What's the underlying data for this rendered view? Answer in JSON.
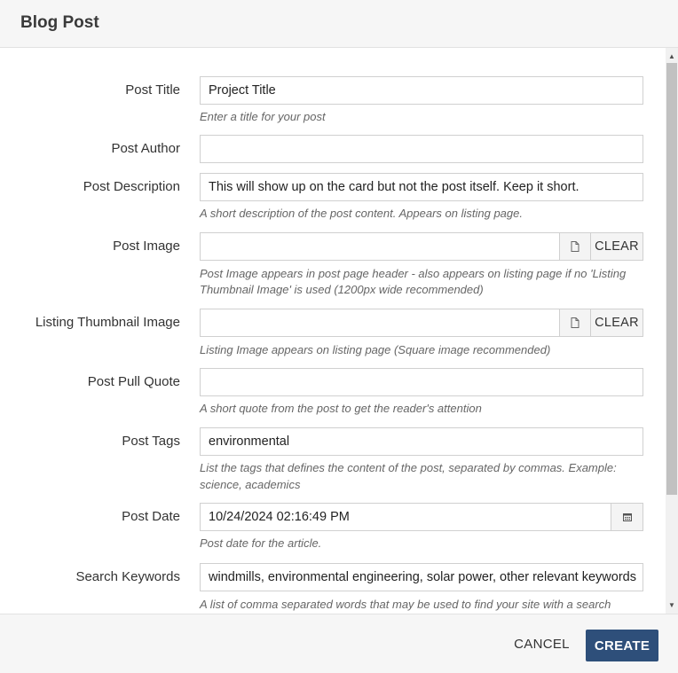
{
  "dialog": {
    "title": "Blog Post"
  },
  "fields": {
    "post_title": {
      "label": "Post Title",
      "value": "Project Title",
      "help": "Enter a title for your post"
    },
    "post_author": {
      "label": "Post Author",
      "value": ""
    },
    "post_description": {
      "label": "Post Description",
      "value": "This will show up on the card but not the post itself. Keep it short.",
      "help": "A short description of the post content. Appears on listing page."
    },
    "post_image": {
      "label": "Post Image",
      "value": "",
      "clear_label": "CLEAR",
      "help_line1": "Post Image appears in post page header - also appears on listing page if no 'Listing",
      "help_line2": "Thumbnail Image' is used (1200px wide recommended)"
    },
    "listing_thumbnail": {
      "label": "Listing Thumbnail Image",
      "value": "",
      "clear_label": "CLEAR",
      "help": "Listing Image appears on listing page (Square image recommended)"
    },
    "pull_quote": {
      "label": "Post Pull Quote",
      "value": "",
      "help": "A short quote from the post to get the reader's attention"
    },
    "post_tags": {
      "label": "Post Tags",
      "value": "environmental",
      "help_line1": "List the tags that defines the content of the post, separated by commas. Example:",
      "help_line2": "science, academics"
    },
    "post_date": {
      "label": "Post Date",
      "value": "10/24/2024 02:16:49 PM",
      "help": "Post date for the article."
    },
    "search_keywords": {
      "label": "Search Keywords",
      "value": "windmills, environmental engineering, solar power, other relevant keywords",
      "help": "A list of comma separated words that may be used to find your site with a search"
    }
  },
  "footer": {
    "cancel_label": "CANCEL",
    "create_label": "CREATE"
  },
  "icons": {
    "file": "file-icon",
    "calendar": "calendar-icon"
  },
  "colors": {
    "primary": "#2e4f7a",
    "header_bg": "#f6f6f6"
  }
}
